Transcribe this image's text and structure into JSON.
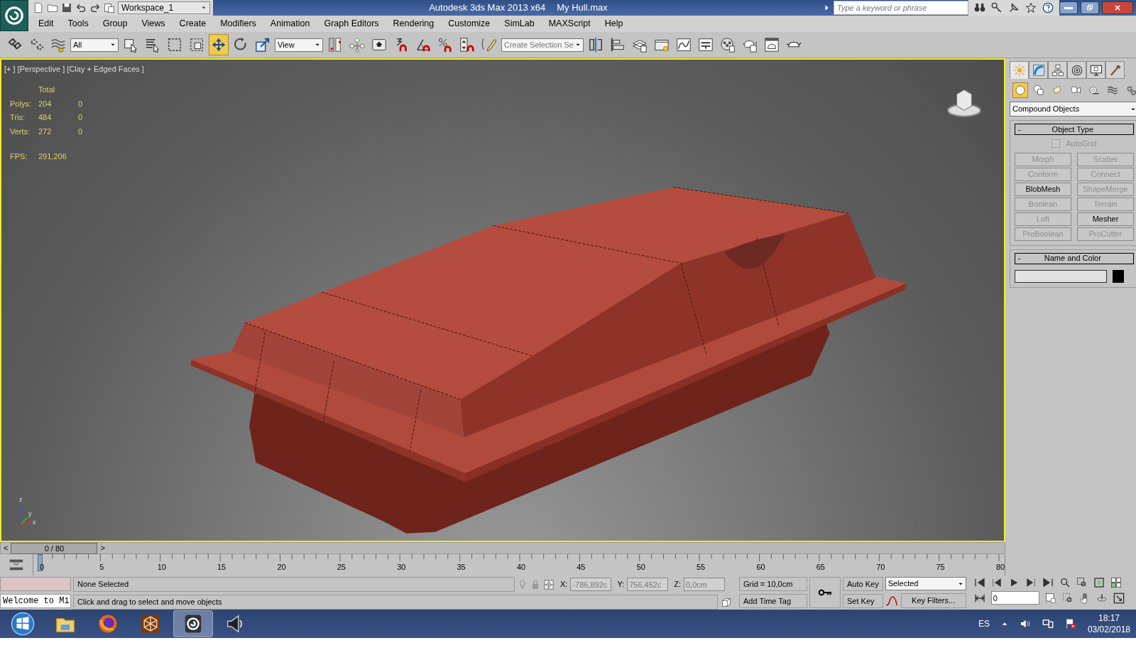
{
  "title_bar": {
    "workspace": "Workspace_1",
    "app_title": "Autodesk 3ds Max  2013 x64",
    "file_name": "My Hull.max",
    "search": {
      "placeholder": "Type a keyword or phrase"
    }
  },
  "menu": [
    "Edit",
    "Tools",
    "Group",
    "Views",
    "Create",
    "Modifiers",
    "Animation",
    "Graph Editors",
    "Rendering",
    "Customize",
    "SimLab",
    "MAXScript",
    "Help"
  ],
  "toolbar": [
    {
      "kind": "link",
      "selected": false
    },
    {
      "kind": "unlink",
      "selected": false
    },
    {
      "kind": "bind",
      "selected": false
    },
    {
      "kind": "dropdown",
      "value": "All"
    },
    {
      "kind": "select",
      "selected": false
    },
    {
      "kind": "selectname",
      "selected": false
    },
    {
      "kind": "region",
      "selected": false
    },
    {
      "kind": "crossing",
      "selected": false
    },
    {
      "kind": "move",
      "selected": true
    },
    {
      "kind": "rotate",
      "selected": false
    },
    {
      "kind": "scale",
      "selected": false
    },
    {
      "kind": "dropdown",
      "value": "View"
    },
    {
      "kind": "pivot",
      "selected": false
    },
    {
      "kind": "manipulate",
      "selected": false
    },
    {
      "kind": "keyboard",
      "selected": false
    },
    {
      "kind": "snap",
      "selected": false
    },
    {
      "kind": "anglesnap",
      "selected": false
    },
    {
      "kind": "percentsnap",
      "selected": false
    },
    {
      "kind": "spinnersnap",
      "selected": false
    },
    {
      "kind": "editnamed",
      "selected": false
    },
    {
      "kind": "combo",
      "placeholder": "Create Selection Se"
    },
    {
      "kind": "mirror",
      "selected": false
    },
    {
      "kind": "align",
      "selected": false
    },
    {
      "kind": "layers",
      "selected": false
    },
    {
      "kind": "explorer",
      "selected": false
    },
    {
      "kind": "curve",
      "selected": false
    },
    {
      "kind": "schematic",
      "selected": false
    },
    {
      "kind": "material",
      "selected": false
    },
    {
      "kind": "rendersetup",
      "selected": false
    },
    {
      "kind": "renderframe",
      "selected": false
    },
    {
      "kind": "render",
      "selected": false
    }
  ],
  "viewport": {
    "label": "[+ ] [Perspective ] [Clay + Edged Faces ]",
    "stats_header": "Total",
    "stats": [
      {
        "label": "Polys:",
        "total": "204",
        "selected": "0"
      },
      {
        "label": "Tris:",
        "total": "484",
        "selected": "0"
      },
      {
        "label": "Verts:",
        "total": "272",
        "selected": "0"
      }
    ],
    "fps_label": "FPS:",
    "fps_value": "291,206",
    "axes": [
      "z",
      "y",
      "x"
    ]
  },
  "command_panel": {
    "tabs": [
      {
        "kind": "create",
        "selected": true
      },
      {
        "kind": "modify",
        "selected": false
      },
      {
        "kind": "hierarchy",
        "selected": false
      },
      {
        "kind": "motion",
        "selected": false
      },
      {
        "kind": "display",
        "selected": false
      },
      {
        "kind": "utilities",
        "selected": false
      }
    ],
    "categories": [
      {
        "kind": "geometry",
        "selected": true
      },
      {
        "kind": "shapes",
        "selected": false
      },
      {
        "kind": "lights",
        "selected": false
      },
      {
        "kind": "cameras",
        "selected": false
      },
      {
        "kind": "helpers",
        "selected": false
      },
      {
        "kind": "spacewarps",
        "selected": false
      },
      {
        "kind": "systems",
        "selected": false
      }
    ],
    "subcategory": "Compound Objects",
    "object_type": {
      "collapse": "-",
      "title": "Object Type",
      "autogrid": {
        "label": "AutoGrid",
        "checked": false,
        "disabled": true
      },
      "buttons": [
        {
          "label": "Morph",
          "disabled": true
        },
        {
          "label": "Scatter",
          "disabled": true
        },
        {
          "label": "Conform",
          "disabled": true
        },
        {
          "label": "Connect",
          "disabled": true
        },
        {
          "label": "BlobMesh",
          "disabled": false
        },
        {
          "label": "ShapeMerge",
          "disabled": true
        },
        {
          "label": "Boolean",
          "disabled": true
        },
        {
          "label": "Terrain",
          "disabled": true
        },
        {
          "label": "Loft",
          "disabled": true
        },
        {
          "label": "Mesher",
          "disabled": false
        },
        {
          "label": "ProBoolean",
          "disabled": true
        },
        {
          "label": "ProCutter",
          "disabled": true
        }
      ]
    },
    "name_and_color": {
      "collapse": "-",
      "title": "Name and Color",
      "color": "#000000"
    }
  },
  "time_slider": {
    "prev": "<",
    "position": "0 / 80",
    "next": ">"
  },
  "trackbar": {
    "labels": [
      "0",
      "5",
      "10",
      "15",
      "20",
      "25",
      "30",
      "35",
      "40",
      "45",
      "50",
      "55",
      "60",
      "65",
      "70",
      "75",
      "80"
    ]
  },
  "status": {
    "listener": "Welcome to Mi",
    "selection": "None Selected",
    "prompt": "Click and drag to select and move objects",
    "x_label": "X:",
    "x_value": "-786,892c",
    "y_label": "Y:",
    "y_value": "756,452c",
    "z_label": "Z:",
    "z_value": "0,0cm",
    "grid": "Grid = 10,0cm",
    "add_time_tag": "Add Time Tag",
    "auto_key": "Auto Key",
    "set_key": "Set Key",
    "key_mode": "Selected",
    "key_filters": "Key Filters...",
    "frame": "0"
  },
  "taskbar": {
    "apps": [
      {
        "kind": "explorer",
        "selected": false
      },
      {
        "kind": "firefox",
        "selected": false
      },
      {
        "kind": "cube",
        "selected": false
      },
      {
        "kind": "max",
        "selected": true
      },
      {
        "kind": "speaker",
        "selected": false
      }
    ],
    "language": "ES",
    "time": "18:17",
    "date": "03/02/2018"
  }
}
